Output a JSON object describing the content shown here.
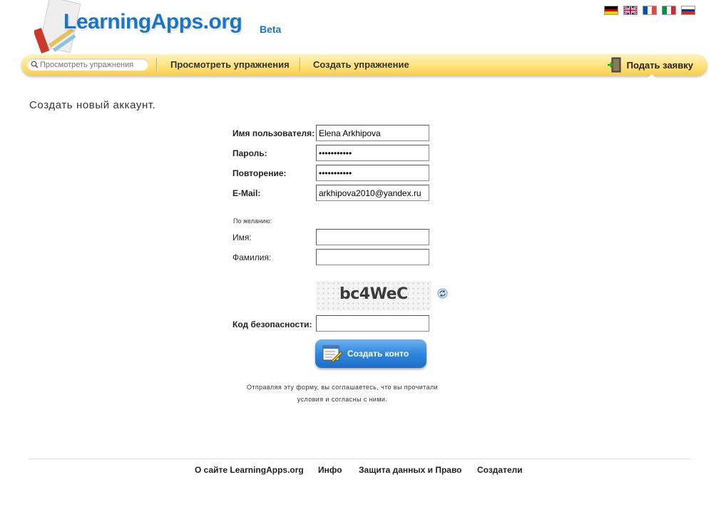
{
  "header": {
    "logo_text": "LearningApps.org",
    "beta_label": "Beta",
    "languages": [
      "German",
      "English",
      "French",
      "Italian",
      "Russian"
    ]
  },
  "nav": {
    "search_placeholder": "Просмотреть упражнения",
    "browse_label": "Просмотреть упражнения",
    "create_label": "Создать упражнение",
    "apply_label": "Подать заявку",
    "apply_icon": "door-exit-icon"
  },
  "page": {
    "title": "Создать новый аккаунт."
  },
  "form": {
    "username_label": "Имя пользователя:",
    "username_value": "Elena Arkhipova",
    "password_label": "Пароль:",
    "password_value": "•••••••••••",
    "repeat_label": "Повторение:",
    "repeat_value": "•••••••••••",
    "email_label": "E-Mail:",
    "email_value": "arkhipova2010@yandex.ru",
    "optional_label": "По желанию:",
    "firstname_label": "Имя:",
    "firstname_value": "",
    "lastname_label": "Фамилия:",
    "lastname_value": "",
    "captcha_text": "bc4WeC",
    "security_label": "Код безопасности:",
    "security_value": "",
    "submit_label": "Создать конто",
    "note_line1": "Отправляя эту форму, вы соглашаетесь, что вы прочитали",
    "note_line2": "условия и согласны с ними."
  },
  "footer": {
    "links": [
      "О сайте LearningApps.org",
      "Инфо",
      "Защита данных и Право",
      "Создатели"
    ]
  },
  "colors": {
    "brand_blue": "#1a74c9",
    "nav_yellow": "#ffe27a",
    "button_blue": "#2e86de"
  }
}
